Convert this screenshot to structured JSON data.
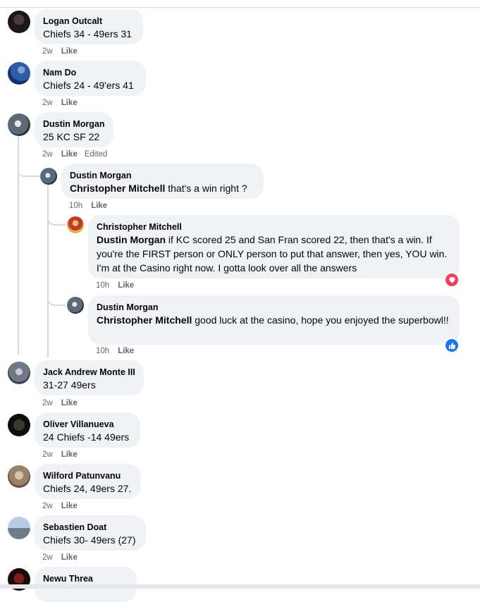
{
  "comments": [
    {
      "author": "Logan Outcalt",
      "text": "Chiefs 34 - 49ers 31",
      "time": "2w",
      "like": "Like"
    },
    {
      "author": "Nam Do",
      "text": "Chiefs 24 - 49'ers 41",
      "time": "2w",
      "like": "Like"
    },
    {
      "author": "Dustin Morgan",
      "text": "25 KC SF 22",
      "time": "2w",
      "like": "Like",
      "edited": "Edited"
    },
    {
      "author": "Jack Andrew Monte III",
      "text": "31-27 49ers",
      "time": "2w",
      "like": "Like"
    },
    {
      "author": "Oliver Villanueva",
      "text": "24 Chiefs -14 49ers",
      "time": "2w",
      "like": "Like"
    },
    {
      "author": "Wilford Patunvanu",
      "text": "Chiefs 24, 49ers 27.",
      "time": "2w",
      "like": "Like"
    },
    {
      "author": "Sebastien Doat",
      "text": "Chiefs 30- 49ers (27)",
      "time": "2w",
      "like": "Like"
    },
    {
      "author": "Newu Threa"
    }
  ],
  "replies": [
    {
      "author": "Dustin Morgan",
      "mention": "Christopher Mitchell",
      "text": " that's a win right ?",
      "time": "10h",
      "like": "Like"
    },
    {
      "author": "Christopher Mitchell",
      "mention": "Dustin Morgan",
      "text": " if KC scored 25 and San Fran scored 22, then that's a win. If you're the FIRST person or ONLY person to put that answer, then yes, YOU win. I'm at the Casino right now. I gotta look over all the answers",
      "time": "10h",
      "like": "Like",
      "reaction": "love-reaction-icon",
      "reaction_color": "#f33e58"
    },
    {
      "author": "Dustin Morgan",
      "mention": "Christopher Mitchell",
      "text": " good luck at the casino, hope you enjoyed the superbowl!!",
      "time": "10h",
      "like": "Like",
      "reaction": "like-reaction-icon",
      "reaction_color": "#1877f2"
    }
  ],
  "colors": {
    "bubble": "#f0f2f5",
    "meta": "#65676b",
    "thread_line": "#d6d9dd"
  }
}
